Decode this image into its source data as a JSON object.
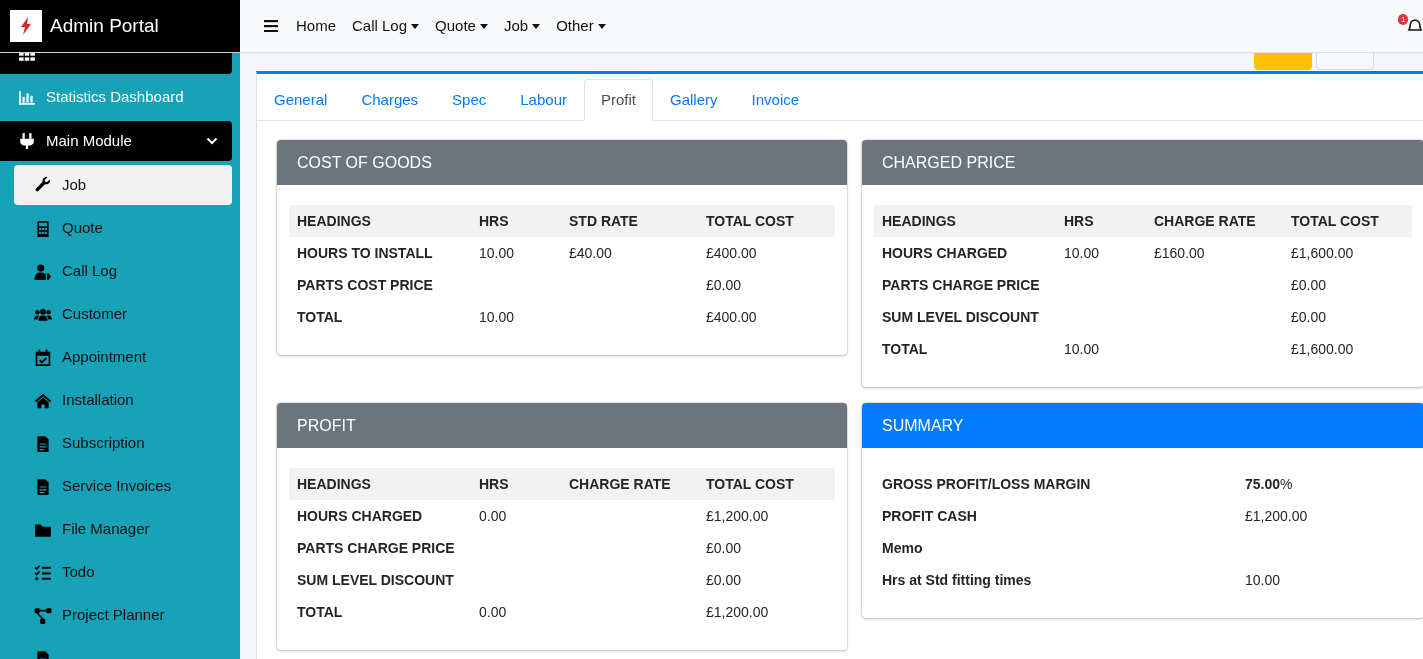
{
  "header": {
    "brand": "Admin Portal",
    "nav": [
      {
        "label": "Home",
        "dropdown": false
      },
      {
        "label": "Call Log",
        "dropdown": true
      },
      {
        "label": "Quote",
        "dropdown": true
      },
      {
        "label": "Job",
        "dropdown": true
      },
      {
        "label": "Other",
        "dropdown": true
      }
    ],
    "notification_count": "1"
  },
  "sidebar": {
    "items": [
      {
        "selected": true
      },
      {
        "label": "Statistics Dashboard",
        "selected": false
      },
      {
        "label": "Main Module",
        "selected": true,
        "expanded": true,
        "children": [
          {
            "label": "Job",
            "selected": true
          },
          {
            "label": "Quote",
            "selected": false
          },
          {
            "label": "Call Log",
            "selected": false
          },
          {
            "label": "Customer",
            "selected": false
          },
          {
            "label": "Appointment",
            "selected": false
          },
          {
            "label": "Installation",
            "selected": false
          },
          {
            "label": "Subscription",
            "selected": false
          },
          {
            "label": "Service Invoices",
            "selected": false
          },
          {
            "label": "File Manager",
            "selected": false
          },
          {
            "label": "Todo",
            "selected": false
          },
          {
            "label": "Project Planner",
            "selected": false
          },
          {
            "selected": false
          }
        ]
      }
    ]
  },
  "buttons": [
    {
      "kind": "primary"
    },
    {
      "kind": "secondary"
    }
  ],
  "tabs": [
    {
      "label": "General",
      "selected": false
    },
    {
      "label": "Charges",
      "selected": false
    },
    {
      "label": "Spec",
      "selected": false
    },
    {
      "label": "Labour",
      "selected": false
    },
    {
      "label": "Profit",
      "selected": true
    },
    {
      "label": "Gallery",
      "selected": false
    },
    {
      "label": "Invoice",
      "selected": false
    }
  ],
  "panels": [
    {
      "title": "COST OF GOODS",
      "kind": "table",
      "columns": [
        "HEADINGS",
        "HRS",
        "STD RATE",
        "TOTAL COST"
      ],
      "rows": [
        [
          "HOURS TO INSTALL",
          "10.00",
          "£40.00",
          "£400.00"
        ],
        [
          "PARTS COST PRICE",
          "",
          "",
          "£0.00"
        ],
        [
          "TOTAL",
          "10.00",
          "",
          "£400.00"
        ]
      ]
    },
    {
      "title": "CHARGED PRICE",
      "kind": "table",
      "columns": [
        "HEADINGS",
        "HRS",
        "CHARGE RATE",
        "TOTAL COST"
      ],
      "rows": [
        [
          "HOURS CHARGED",
          "10.00",
          "£160.00",
          "£1,600.00"
        ],
        [
          "PARTS CHARGE PRICE",
          "",
          "",
          "£0.00"
        ],
        [
          "SUM LEVEL DISCOUNT",
          "",
          "",
          "£0.00"
        ],
        [
          "TOTAL",
          "10.00",
          "",
          "£1,600.00"
        ]
      ]
    },
    {
      "title": "PROFIT",
      "kind": "table",
      "columns": [
        "HEADINGS",
        "HRS",
        "CHARGE RATE",
        "TOTAL COST"
      ],
      "rows": [
        [
          "HOURS CHARGED",
          "0.00",
          "",
          "£1,200.00"
        ],
        [
          "PARTS CHARGE PRICE",
          "",
          "",
          "£0.00"
        ],
        [
          "SUM LEVEL DISCOUNT",
          "",
          "",
          "£0.00"
        ],
        [
          "TOTAL",
          "0.00",
          "",
          "£1,200.00"
        ]
      ]
    },
    {
      "title": "SUMMARY",
      "kind": "summary",
      "rows": [
        {
          "label": "GROSS PROFIT/LOSS MARGIN",
          "value": "**75.00**%"
        },
        {
          "label": "PROFIT CASH",
          "value": "£1,200.00"
        },
        {
          "label": "Memo",
          "value": ""
        },
        {
          "label": "Hrs at Std fitting times",
          "value": "10.00"
        }
      ]
    }
  ]
}
